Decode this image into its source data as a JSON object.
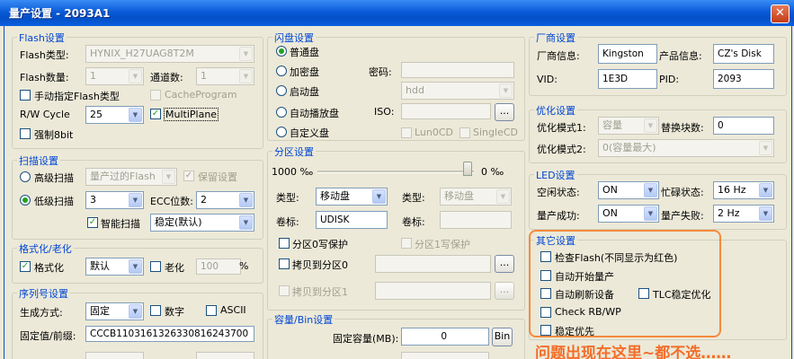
{
  "window": {
    "title": "量产设置 - 2093A1",
    "close": "✕"
  },
  "flash": {
    "title": "Flash设置",
    "type_label": "Flash类型:",
    "type_value": "HYNIX_H27UAG8T2M",
    "count_label": "Flash数量:",
    "count_value": "1",
    "channel_label": "通道数:",
    "channel_value": "1",
    "manual_label": "手动指定Flash类型",
    "cache_label": "CacheProgram",
    "rw_label": "R/W Cycle",
    "rw_value": "25",
    "multiplane_label": "MultiPlane",
    "force8_label": "强制8bit"
  },
  "scan": {
    "title": "扫描设置",
    "high_label": "高级扫描",
    "high_value": "量产过的Flash",
    "keep_label": "保留设置",
    "low_label": "低级扫描",
    "low_value": "3",
    "ecc_label": "ECC位数:",
    "ecc_value": "2",
    "smart_label": "智能扫描",
    "smart_value": "稳定(默认)"
  },
  "format": {
    "title": "格式化/老化",
    "format_label": "格式化",
    "format_value": "默认",
    "aging_label": "老化",
    "aging_value": "100",
    "percent": "%"
  },
  "serial": {
    "title": "序列号设置",
    "mode_label": "生成方式:",
    "mode_value": "固定",
    "digit_label": "数字",
    "ascii_label": "ASCII",
    "fixed_label": "固定值/前缀:",
    "fixed_value": "CCCB1103161326330816243700",
    "partial_label": "... ..."
  },
  "udisk": {
    "title": "闪盘设置",
    "normal_label": "普通盘",
    "encrypt_label": "加密盘",
    "pwd_label": "密码:",
    "boot_label": "启动盘",
    "boot_value": "hdd",
    "autorun_label": "自动播放盘",
    "iso_label": "ISO:",
    "browse": "...",
    "custom_label": "自定义盘",
    "lun0cd_label": "Lun0CD",
    "singlecd_label": "SingleCD"
  },
  "partition": {
    "title": "分区设置",
    "left_value": "1000 ‰",
    "right_value": "0 ‰",
    "type_label": "类型:",
    "type_value": "移动盘",
    "type2_label": "类型:",
    "type2_value": "移动盘",
    "vol_label": "卷标:",
    "vol_value": "UDISK",
    "vol2_label": "卷标:",
    "wp0_label": "分区0写保护",
    "wp1_label": "分区1写保护",
    "copy0_label": "拷贝到分区0",
    "copy1_label": "拷贝到分区1",
    "browse": "..."
  },
  "capacity": {
    "title": "容量/Bin设置",
    "fixed_label": "固定容量(MB):",
    "fixed_value": "0",
    "bin_button": "Bin"
  },
  "vendor": {
    "title": "厂商设置",
    "vendor_label": "厂商信息:",
    "vendor_value": "Kingston",
    "product_label": "产品信息:",
    "product_value": "CZ's Disk",
    "vid_label": "VID:",
    "vid_value": "1E3D",
    "pid_label": "PID:",
    "pid_value": "2093"
  },
  "optimize": {
    "title": "优化设置",
    "mode1_label": "优化模式1:",
    "mode1_value": "容量",
    "replace_label": "替换块数:",
    "replace_value": "0",
    "mode2_label": "优化模式2:",
    "mode2_value": "0(容量最大)"
  },
  "led": {
    "title": "LED设置",
    "idle_label": "空闲状态:",
    "idle_value": "ON",
    "busy_label": "忙碌状态:",
    "busy_value": "16 Hz",
    "success_label": "量产成功:",
    "success_value": "ON",
    "fail_label": "量产失败:",
    "fail_value": "2 Hz"
  },
  "other": {
    "title": "其它设置",
    "check_flash": "检查Flash(不同显示为红色)",
    "auto_start": "自动开始量产",
    "auto_refresh": "自动刷新设备",
    "tlc": "TLC稳定优化",
    "check_rb": "Check RB/WP",
    "stable": "稳定优先"
  },
  "annotation": {
    "text": "问题出现在这里~都不选……",
    "color": "#f26e2a"
  }
}
